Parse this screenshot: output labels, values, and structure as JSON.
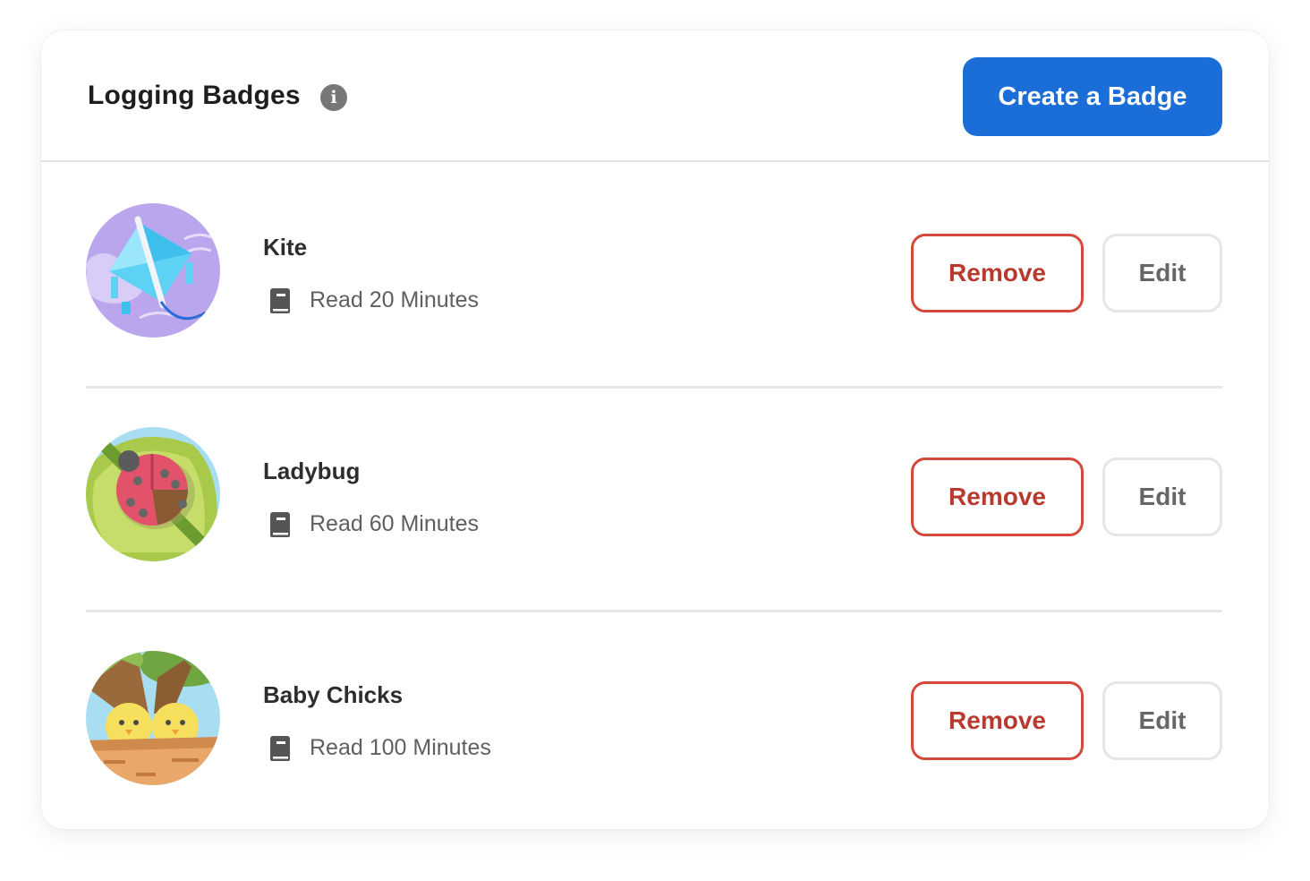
{
  "header": {
    "title": "Logging Badges",
    "info_icon": "info-icon",
    "create_button_label": "Create a Badge"
  },
  "badges": [
    {
      "name": "Kite",
      "icon": "book-icon",
      "requirement": "Read 20 Minutes",
      "remove_label": "Remove",
      "edit_label": "Edit"
    },
    {
      "name": "Ladybug",
      "icon": "book-icon",
      "requirement": "Read 60 Minutes",
      "remove_label": "Remove",
      "edit_label": "Edit"
    },
    {
      "name": "Baby Chicks",
      "icon": "book-icon",
      "requirement": "Read 100 Minutes",
      "remove_label": "Remove",
      "edit_label": "Edit"
    }
  ],
  "colors": {
    "primary": "#1b6ed8",
    "danger": "#d6483b",
    "neutral_border": "#e6e6e6"
  }
}
